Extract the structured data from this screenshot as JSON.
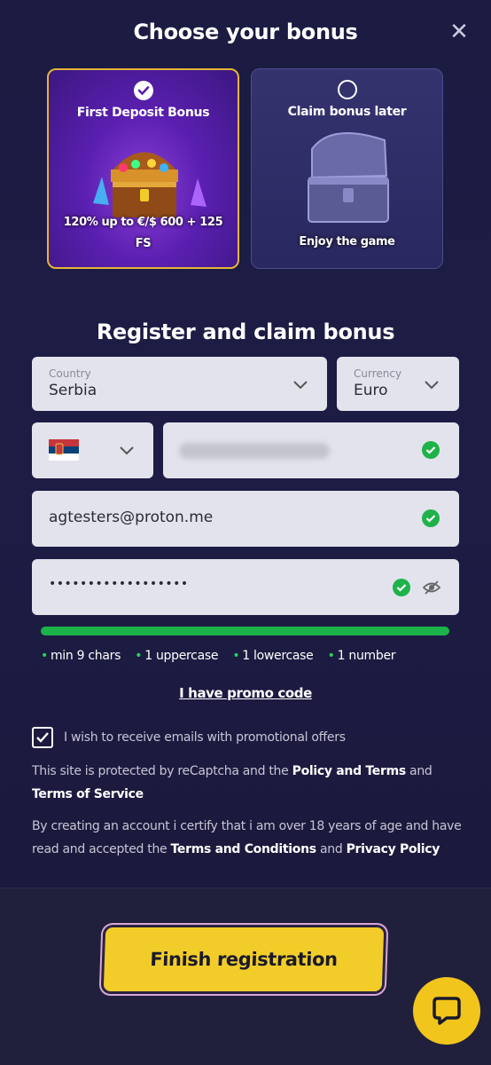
{
  "header": {
    "title": "Choose your bonus",
    "close_label": "✕"
  },
  "bonuses": [
    {
      "title": "First Deposit Bonus",
      "subtitle": "120% up to €/$ 600 + 125 FS",
      "selected": true
    },
    {
      "title": "Claim bonus later",
      "subtitle": "Enjoy the game",
      "selected": false
    }
  ],
  "form": {
    "heading": "Register and claim bonus",
    "country": {
      "label": "Country",
      "value": "Serbia"
    },
    "currency": {
      "label": "Currency",
      "value": "Euro"
    },
    "email": {
      "value": "agtesters@proton.me"
    },
    "password": {
      "value": "••••••••••••••••••"
    },
    "password_strength": 1.0,
    "rules": [
      "min 9 chars",
      "1 uppercase",
      "1 lowercase",
      "1 number"
    ],
    "promo_link": "I have promo code",
    "newsletter": {
      "label": "I wish to receive emails with promotional offers",
      "checked": true
    }
  },
  "legal": {
    "recaptcha_prefix": "This site is protected by reCaptcha and the ",
    "policy_terms": "Policy and Terms",
    "and": " and ",
    "terms_of_service": "Terms of Service",
    "age_prefix": "By creating an account i certify that i am over 18 years of age and have read and accepted the ",
    "terms_conditions": "Terms and Conditions",
    "and2": " and ",
    "privacy_policy": "Privacy Policy"
  },
  "footer": {
    "finish_label": "Finish registration"
  },
  "colors": {
    "accent_yellow": "#f2cd2a",
    "success_green": "#1fb24a",
    "bg_navy": "#1c1b42"
  }
}
